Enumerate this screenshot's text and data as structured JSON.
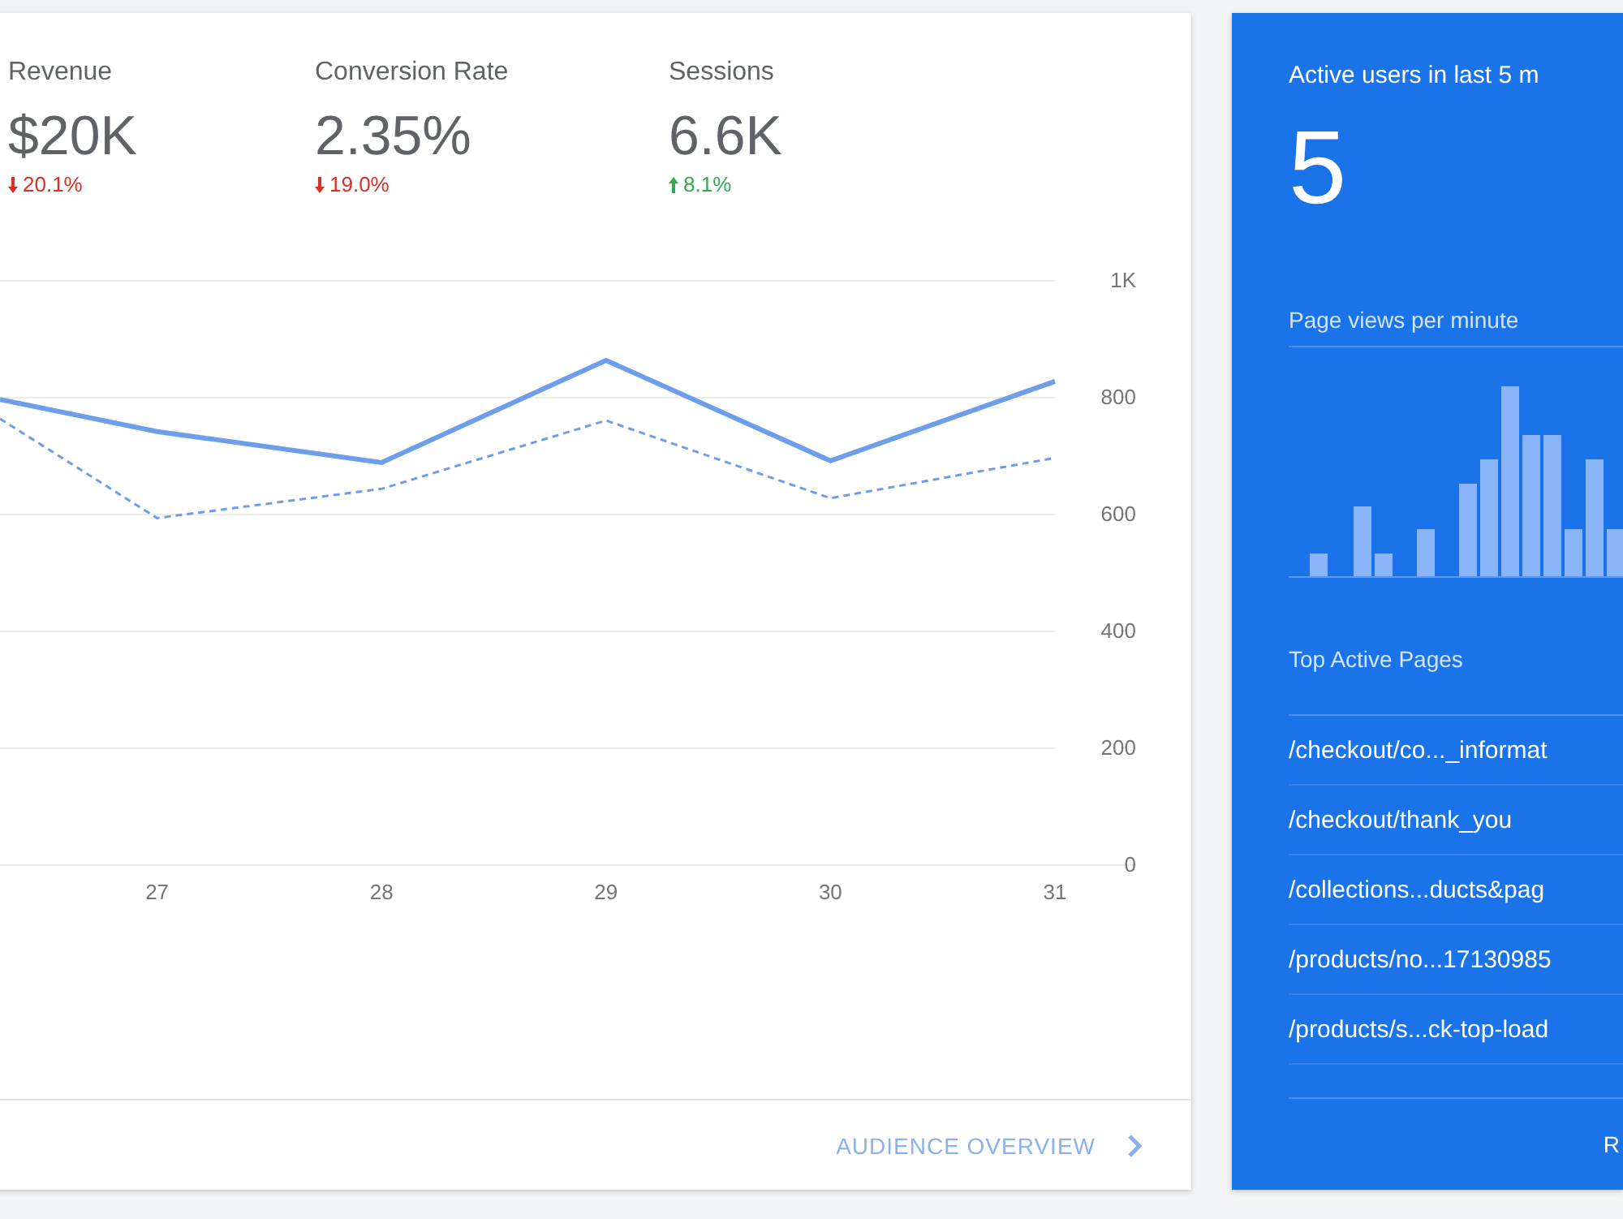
{
  "overview_card": {
    "metrics": [
      {
        "label": "Revenue",
        "value": "$20K",
        "change": "20.1%",
        "kind": "down"
      },
      {
        "label": "Conversion Rate",
        "value": "2.35%",
        "change": "19.0%",
        "kind": "down"
      },
      {
        "label": "Sessions",
        "value": "6.6K",
        "change": "8.1%",
        "kind": "up"
      }
    ],
    "chart_data": {
      "type": "line",
      "x": [
        26.3,
        27,
        28,
        29,
        30,
        31
      ],
      "xlim": [
        26.3,
        31
      ],
      "xticks": [
        27,
        28,
        29,
        30,
        31
      ],
      "ylim": [
        0,
        1000
      ],
      "grid": true,
      "yticks": [
        0,
        200,
        400,
        600,
        800,
        {
          "value": 1000,
          "label": "1K"
        }
      ],
      "series": [
        {
          "color": "#6d9eeb",
          "line_style": "solid",
          "values": [
            797,
            742,
            689,
            864,
            692,
            828
          ]
        },
        {
          "color": "#6d9eeb",
          "line_style": "dashed",
          "values": [
            764,
            594,
            644,
            761,
            628,
            697
          ]
        }
      ]
    },
    "footer_link": "AUDIENCE OVERVIEW"
  },
  "realtime_card": {
    "title": "Active users in last 5 m",
    "active_users": "5",
    "page_views_label": "Page views per minute",
    "top_pages_label": "Top Active Pages",
    "top_pages": [
      "/checkout/co..._informat",
      "/checkout/thank_you",
      "/collections...ducts&pag",
      "/products/no...17130985",
      "/products/s...ck-top-load"
    ],
    "footer_link": "R"
  }
}
